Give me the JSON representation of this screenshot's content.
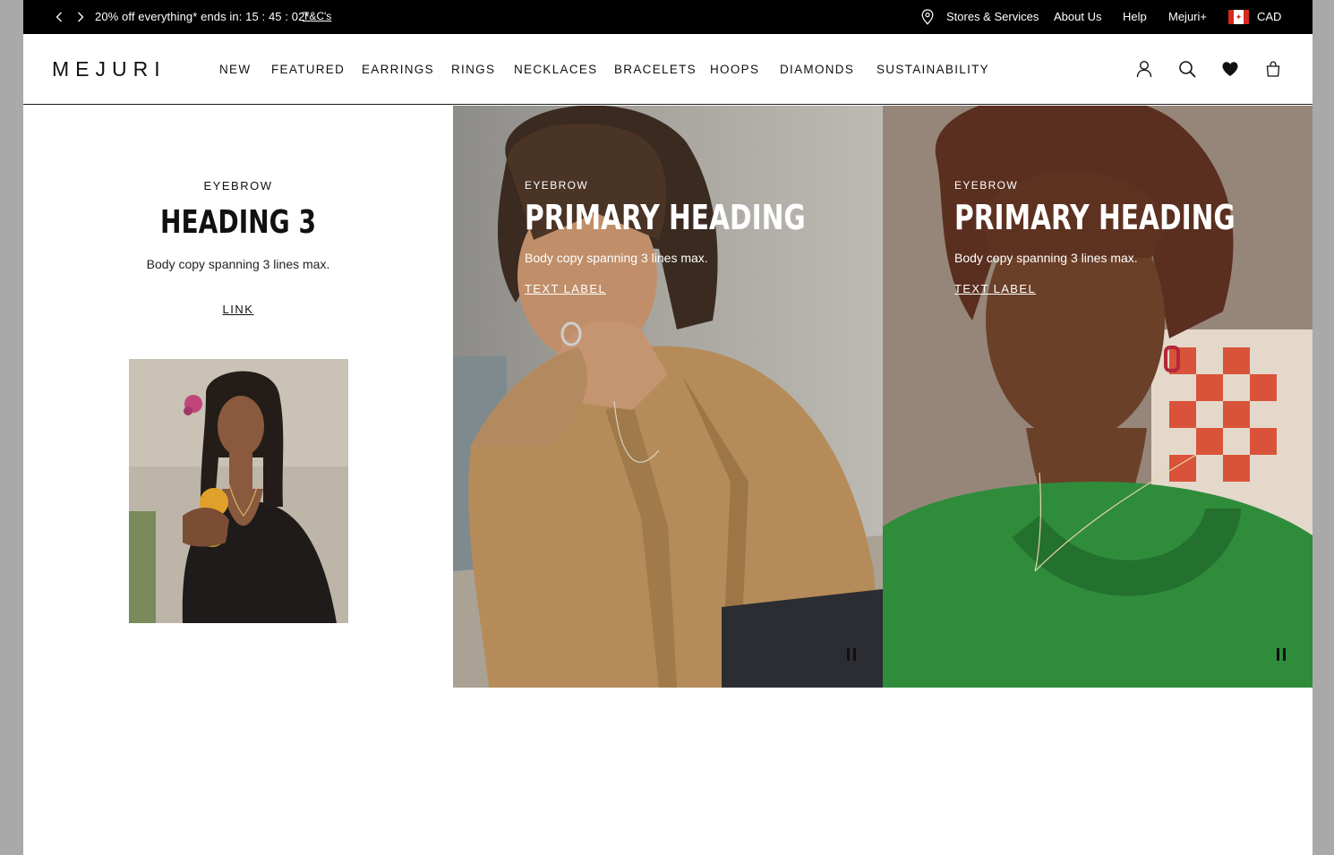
{
  "promo_bar": {
    "prev_icon": "chevron-left-icon",
    "next_icon": "chevron-right-icon",
    "message": "20% off everything* ends in: 15 : 45 : 02*",
    "terms_link": "T&C's",
    "utility_links": [
      {
        "label": "Stores & Services",
        "icon": "map-pin-icon"
      },
      {
        "label": "About Us"
      },
      {
        "label": "Help"
      },
      {
        "label": "Mejuri+"
      }
    ],
    "currency": {
      "label": "CAD",
      "icon": "canada-flag-icon"
    }
  },
  "header": {
    "logo": "MEJURI",
    "nav": [
      "NEW",
      "FEATURED",
      "EARRINGS",
      "RINGS",
      "NECKLACES",
      "BRACELETS",
      "HOOPS",
      "DIAMONDS",
      "SUSTAINABILITY"
    ],
    "icons": [
      "account-icon",
      "search-icon",
      "wishlist-heart-icon",
      "shopping-bag-icon"
    ]
  },
  "left_block": {
    "eyebrow": "EYEBROW",
    "heading": "HEADING 3",
    "body": "Body copy spanning 3 lines max.",
    "link": "LINK"
  },
  "tiles": [
    {
      "eyebrow": "EYEBROW",
      "heading": "PRIMARY HEADING",
      "body": "Body copy spanning 3 lines max.",
      "link": "TEXT LABEL",
      "control_icon": "pause-icon"
    },
    {
      "eyebrow": "EYEBROW",
      "heading": "PRIMARY HEADING",
      "body": "Body copy spanning 3 lines max.",
      "link": "TEXT LABEL",
      "control_icon": "pause-icon"
    }
  ],
  "colors": {
    "promo_bar_bg": "#000000",
    "text_primary": "#111111",
    "page_bg": "#ffffff",
    "canada_red": "#d52b1e"
  }
}
